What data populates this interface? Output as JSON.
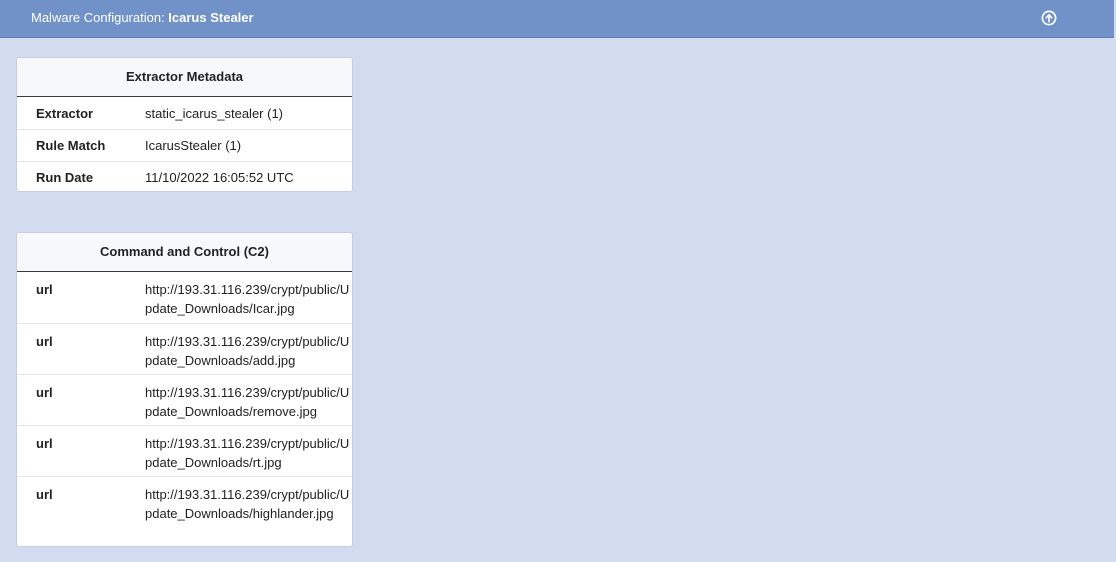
{
  "header": {
    "title_prefix": "Malware Configuration: ",
    "title_name": "Icarus Stealer",
    "collapse_icon": "circle-arrow-up-icon"
  },
  "metadata": {
    "heading": "Extractor Metadata",
    "rows": [
      {
        "key": "Extractor",
        "value": "static_icarus_stealer (1)"
      },
      {
        "key": "Rule Match",
        "value": "IcarusStealer (1)"
      },
      {
        "key": "Run Date",
        "value": "11/10/2022 16:05:52 UTC"
      }
    ]
  },
  "c2": {
    "heading": "Command and Control (C2)",
    "rows": [
      {
        "key": "url",
        "value": "http://193.31.116.239/crypt/public/Update_Downloads/Icar.jpg"
      },
      {
        "key": "url",
        "value": "http://193.31.116.239/crypt/public/Update_Downloads/add.jpg"
      },
      {
        "key": "url",
        "value": "http://193.31.116.239/crypt/public/Update_Downloads/remove.jpg"
      },
      {
        "key": "url",
        "value": "http://193.31.116.239/crypt/public/Update_Downloads/rt.jpg"
      },
      {
        "key": "url",
        "value": "http://193.31.116.239/crypt/public/Update_Downloads/highlander.jpg"
      }
    ]
  },
  "colors": {
    "header_bg": "#7192c8",
    "page_bg": "#d2dcee",
    "card_bg": "#ffffff"
  }
}
